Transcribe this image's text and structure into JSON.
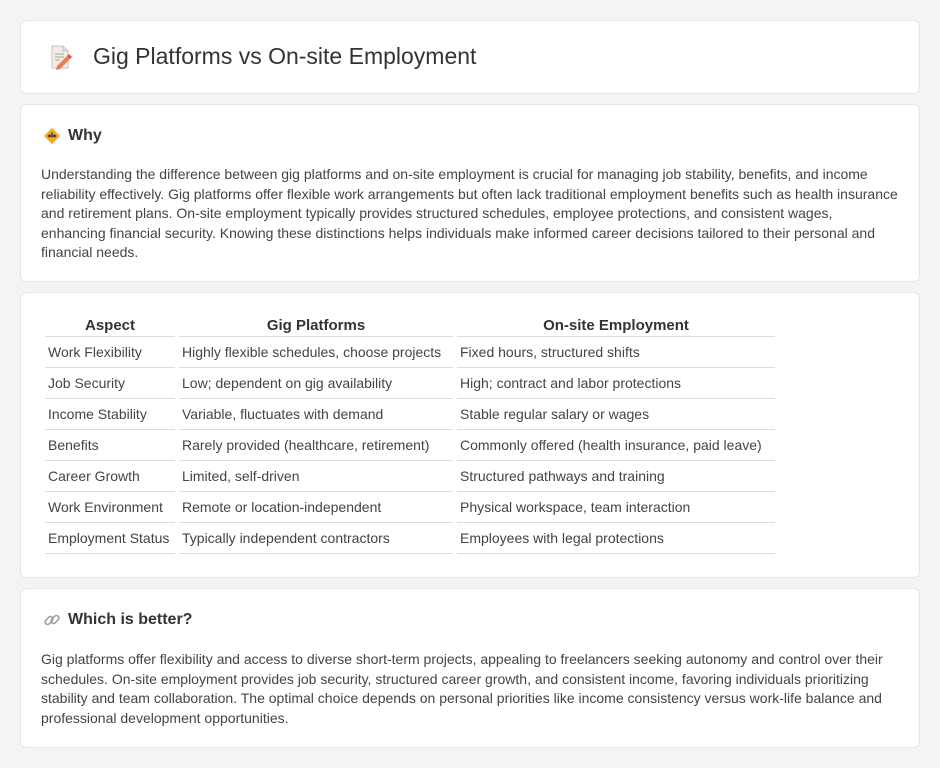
{
  "header": {
    "title": "Gig Platforms vs On-site Employment",
    "icon": "document-pencil-icon"
  },
  "why": {
    "title": "Why",
    "icon": "warning-diamond-icon",
    "text": "Understanding the difference between gig platforms and on-site employment is crucial for managing job stability, benefits, and income reliability effectively. Gig platforms offer flexible work arrangements but often lack traditional employment benefits such as health insurance and retirement plans. On-site employment typically provides structured schedules, employee protections, and consistent wages, enhancing financial security. Knowing these distinctions helps individuals make informed career decisions tailored to their personal and financial needs."
  },
  "table": {
    "headers": [
      "Aspect",
      "Gig Platforms",
      "On-site Employment"
    ],
    "rows": [
      [
        "Work Flexibility",
        "Highly flexible schedules, choose projects",
        "Fixed hours, structured shifts"
      ],
      [
        "Job Security",
        "Low; dependent on gig availability",
        "High; contract and labor protections"
      ],
      [
        "Income Stability",
        "Variable, fluctuates with demand",
        "Stable regular salary or wages"
      ],
      [
        "Benefits",
        "Rarely provided (healthcare, retirement)",
        "Commonly offered (health insurance, paid leave)"
      ],
      [
        "Career Growth",
        "Limited, self-driven",
        "Structured pathways and training"
      ],
      [
        "Work Environment",
        "Remote or location-independent",
        "Physical workspace, team interaction"
      ],
      [
        "Employment Status",
        "Typically independent contractors",
        "Employees with legal protections"
      ]
    ]
  },
  "better": {
    "title": "Which is better?",
    "icon": "link-icon",
    "text": "Gig platforms offer flexibility and access to diverse short-term projects, appealing to freelancers seeking autonomy and control over their schedules. On-site employment provides job security, structured career growth, and consistent income, favoring individuals prioritizing stability and team collaboration. The optimal choice depends on personal priorities like income consistency versus work-life balance and professional development opportunities."
  }
}
